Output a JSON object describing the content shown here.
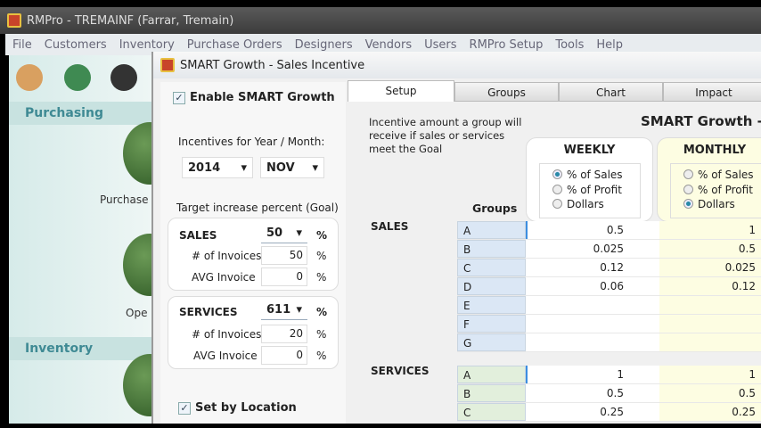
{
  "app": {
    "title": "RMPro - TREMAINF (Farrar, Tremain)"
  },
  "menu": [
    "File",
    "Customers",
    "Inventory",
    "Purchase Orders",
    "Designers",
    "Vendors",
    "Users",
    "RMPro Setup",
    "Tools",
    "Help"
  ],
  "sidebar": {
    "sections": [
      {
        "title": "Purchasing",
        "items": [
          "Purchase",
          "Ope"
        ]
      },
      {
        "title": "Inventory"
      }
    ]
  },
  "dialog": {
    "title": "SMART Growth - Sales Incentive",
    "enable_label": "Enable SMART Growth",
    "enable_checked": true,
    "period_label": "Incentives for Year / Month:",
    "year": "2014",
    "month": "NOV",
    "target_label": "Target increase percent (Goal)",
    "sales": {
      "label": "SALES",
      "value": "50",
      "invoices_label": "# of Invoices",
      "invoices": "50",
      "avg_label": "AVG Invoice",
      "avg": "0",
      "pct": "%"
    },
    "services": {
      "label": "SERVICES",
      "value": "611",
      "invoices_label": "# of Invoices",
      "invoices": "20",
      "avg_label": "AVG Invoice",
      "avg": "0",
      "pct": "%"
    },
    "location_label": "Set by Location",
    "location_checked": true,
    "tabs": [
      "Setup",
      "Groups",
      "Chart",
      "Impact"
    ],
    "active_tab": "Setup",
    "description": "Incentive amount a group will receive if sales or services meet the Goal",
    "heading": "SMART Growth -",
    "groups_label": "Groups",
    "weekly": {
      "title": "WEEKLY",
      "options": [
        "% of Sales",
        "% of Profit",
        "Dollars"
      ],
      "selected": "% of Sales"
    },
    "monthly": {
      "title": "MONTHLY",
      "options": [
        "% of Sales",
        "% of Profit",
        "Dollars"
      ],
      "selected": "Dollars"
    },
    "sales_section": "SALES",
    "sales_rows": [
      {
        "g": "A",
        "w": "0.5",
        "m": "1"
      },
      {
        "g": "B",
        "w": "0.025",
        "m": "0.5"
      },
      {
        "g": "C",
        "w": "0.12",
        "m": "0.025"
      },
      {
        "g": "D",
        "w": "0.06",
        "m": "0.12"
      },
      {
        "g": "E",
        "w": "",
        "m": ""
      },
      {
        "g": "F",
        "w": "",
        "m": ""
      },
      {
        "g": "G",
        "w": "",
        "m": ""
      }
    ],
    "services_section": "SERVICES",
    "services_rows": [
      {
        "g": "A",
        "w": "1",
        "m": "1"
      },
      {
        "g": "B",
        "w": "0.5",
        "m": "0.5"
      },
      {
        "g": "C",
        "w": "0.25",
        "m": "0.25"
      }
    ]
  }
}
